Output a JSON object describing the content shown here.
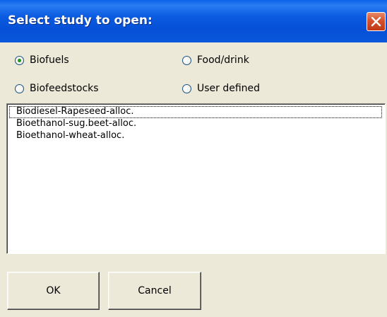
{
  "dialog": {
    "title": "Select study to open:"
  },
  "options": [
    {
      "label": "Biofuels",
      "checked": true
    },
    {
      "label": "Food/drink",
      "checked": false
    },
    {
      "label": "Biofeedstocks",
      "checked": false
    },
    {
      "label": "User defined",
      "checked": false
    }
  ],
  "studies": [
    "Biodiesel-Rapeseed-alloc.",
    "Bioethanol-sug.beet-alloc.",
    "Bioethanol-wheat-alloc."
  ],
  "buttons": {
    "ok_label": "OK",
    "cancel_label": "Cancel"
  },
  "colors": {
    "title_bar": "#0a5ae0",
    "dialog_background": "#ece9d8",
    "close_button": "#d6502c",
    "radio_dot": "#21a121"
  }
}
